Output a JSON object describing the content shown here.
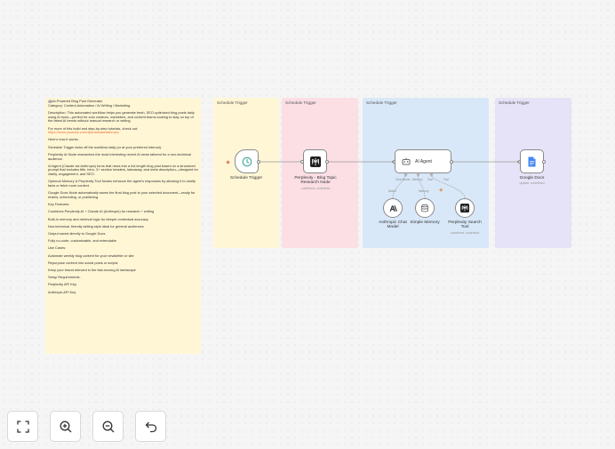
{
  "note": {
    "lines": [
      "🤖AI-Powered Blog Post Generator\nCategory: Content Automation / AI Writing / Marketing",
      "Description:\nThis automated workflow helps you generate fresh, SEO-optimized blog posts daily using AI tools—perfect for solo creators, marketers, and content teams looking to stay on top of the latest AI trends without manual research or writing.",
      "For more of this build and step-by-step tutorials, check out:",
      "Here's how it works:",
      "Schedule Trigger kicks off the workflow daily (or at your preferred interval).",
      "Perplexity AI Node researches the most interesting recent AI news tailored for a non-technical audience.",
      "AI Agent (Claude via Anthropic) turns that news into a full-length blog post based on a structured prompt that includes title, intro, 3+ section headers, takeaway, and meta description—designed for clarity, engagement, and SEO.",
      "Optional Memory & Perplexity Tool Nodes enhance the agent's responses by allowing it to clarify facts or fetch more context.",
      "Google Docs Node automatically saves the final blog post to your selected document—ready for review, scheduling, or publishing.",
      "Key Features:",
      "Combines Perplexity AI + Claude AI (Anthropic) for research + writing",
      "Built-in memory and retrieval logic for deeper contextual accuracy",
      "Non-technical, friendly writing style ideal for general audiences",
      "Output saved directly to Google Docs",
      "Fully no-code, customizable, and extendable",
      "Use Cases:",
      "Automate weekly blog content for your newsletter or site",
      "Repurpose content into social posts or scripts",
      "Keep your brand relevant in the fast-moving AI landscape",
      "Setup Requirements:",
      "Perplexity API Key",
      "Anthropic API Key"
    ],
    "link": "https://www.youtube.com/@automatewithmarc"
  },
  "groups": {
    "a": "Schedule Trigger",
    "b": "Schedule Trigger",
    "c": "Schedule Trigger",
    "d": "Schedule Trigger"
  },
  "nodes": {
    "schedule": {
      "label": "Schedule Trigger"
    },
    "perplexity": {
      "label": "Perplexity - Blog Topic\nResearch Node",
      "sub": "undefined: undefined"
    },
    "agent": {
      "label": "AI Agent"
    },
    "gdocs": {
      "label": "Google Docs",
      "sub": "update: undefined"
    },
    "anthropic": {
      "label": "Anthropic Chat\nModel"
    },
    "memory": {
      "label": "Simple Memory"
    },
    "ptool": {
      "label": "Perplexity Search\nTool",
      "sub": "undefined: undefined"
    }
  },
  "agent_ports": {
    "chat_model": "Chat Model",
    "memory": "Memory",
    "tool": "Tool",
    "model_below": "Model",
    "memory_below": "Memory",
    "tool_below": "Tool"
  },
  "controls": {
    "fit": "fit-view",
    "zoom_in": "zoom-in",
    "zoom_out": "zoom-out",
    "undo": "undo"
  }
}
